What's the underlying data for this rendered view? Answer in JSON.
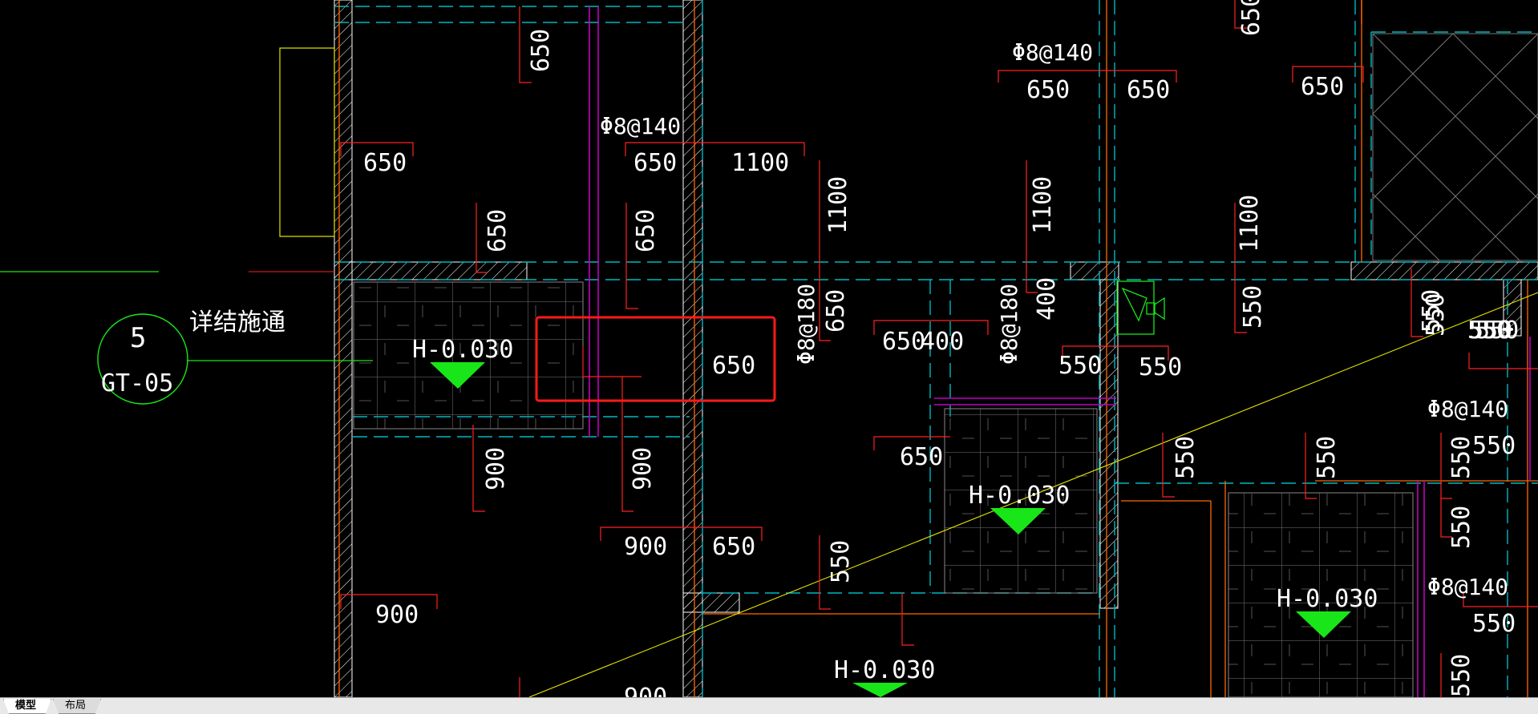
{
  "colors": {
    "background": "#000000",
    "dimension": "#ff2020",
    "axis": "#00b7c3",
    "wall": "#ffffff",
    "beam": "#ff6a00",
    "column": "#c000c0",
    "marker": "#19e619",
    "leader": "#ffff00",
    "highlight": "#ff1a1a"
  },
  "drawing": {
    "dims": [
      "650",
      "650",
      "650",
      "1100",
      "650",
      "650",
      "650",
      "1100",
      "650",
      "650",
      "650",
      "1100",
      "1100",
      "650",
      "400",
      "650",
      "400",
      "550",
      "650",
      "550",
      "550",
      "550",
      "550",
      "550",
      "900",
      "900",
      "900",
      "650",
      "650",
      "550",
      "550",
      "550",
      "550",
      "550",
      "550",
      "550",
      "550",
      "550",
      "550",
      "900",
      "900"
    ],
    "rebar_labels": [
      "Φ8@140",
      "Φ8@140",
      "Φ8@180",
      "Φ8@180",
      "Φ8@140",
      "Φ8@140"
    ],
    "elevations": [
      "H-0.030",
      "H-0.030",
      "H-0.030",
      "H-0.030"
    ],
    "detail_callout": {
      "number": "5",
      "sheet": "GT-05",
      "note": "详结施通"
    }
  },
  "tabs": {
    "model": "模型",
    "layout": "布局"
  }
}
